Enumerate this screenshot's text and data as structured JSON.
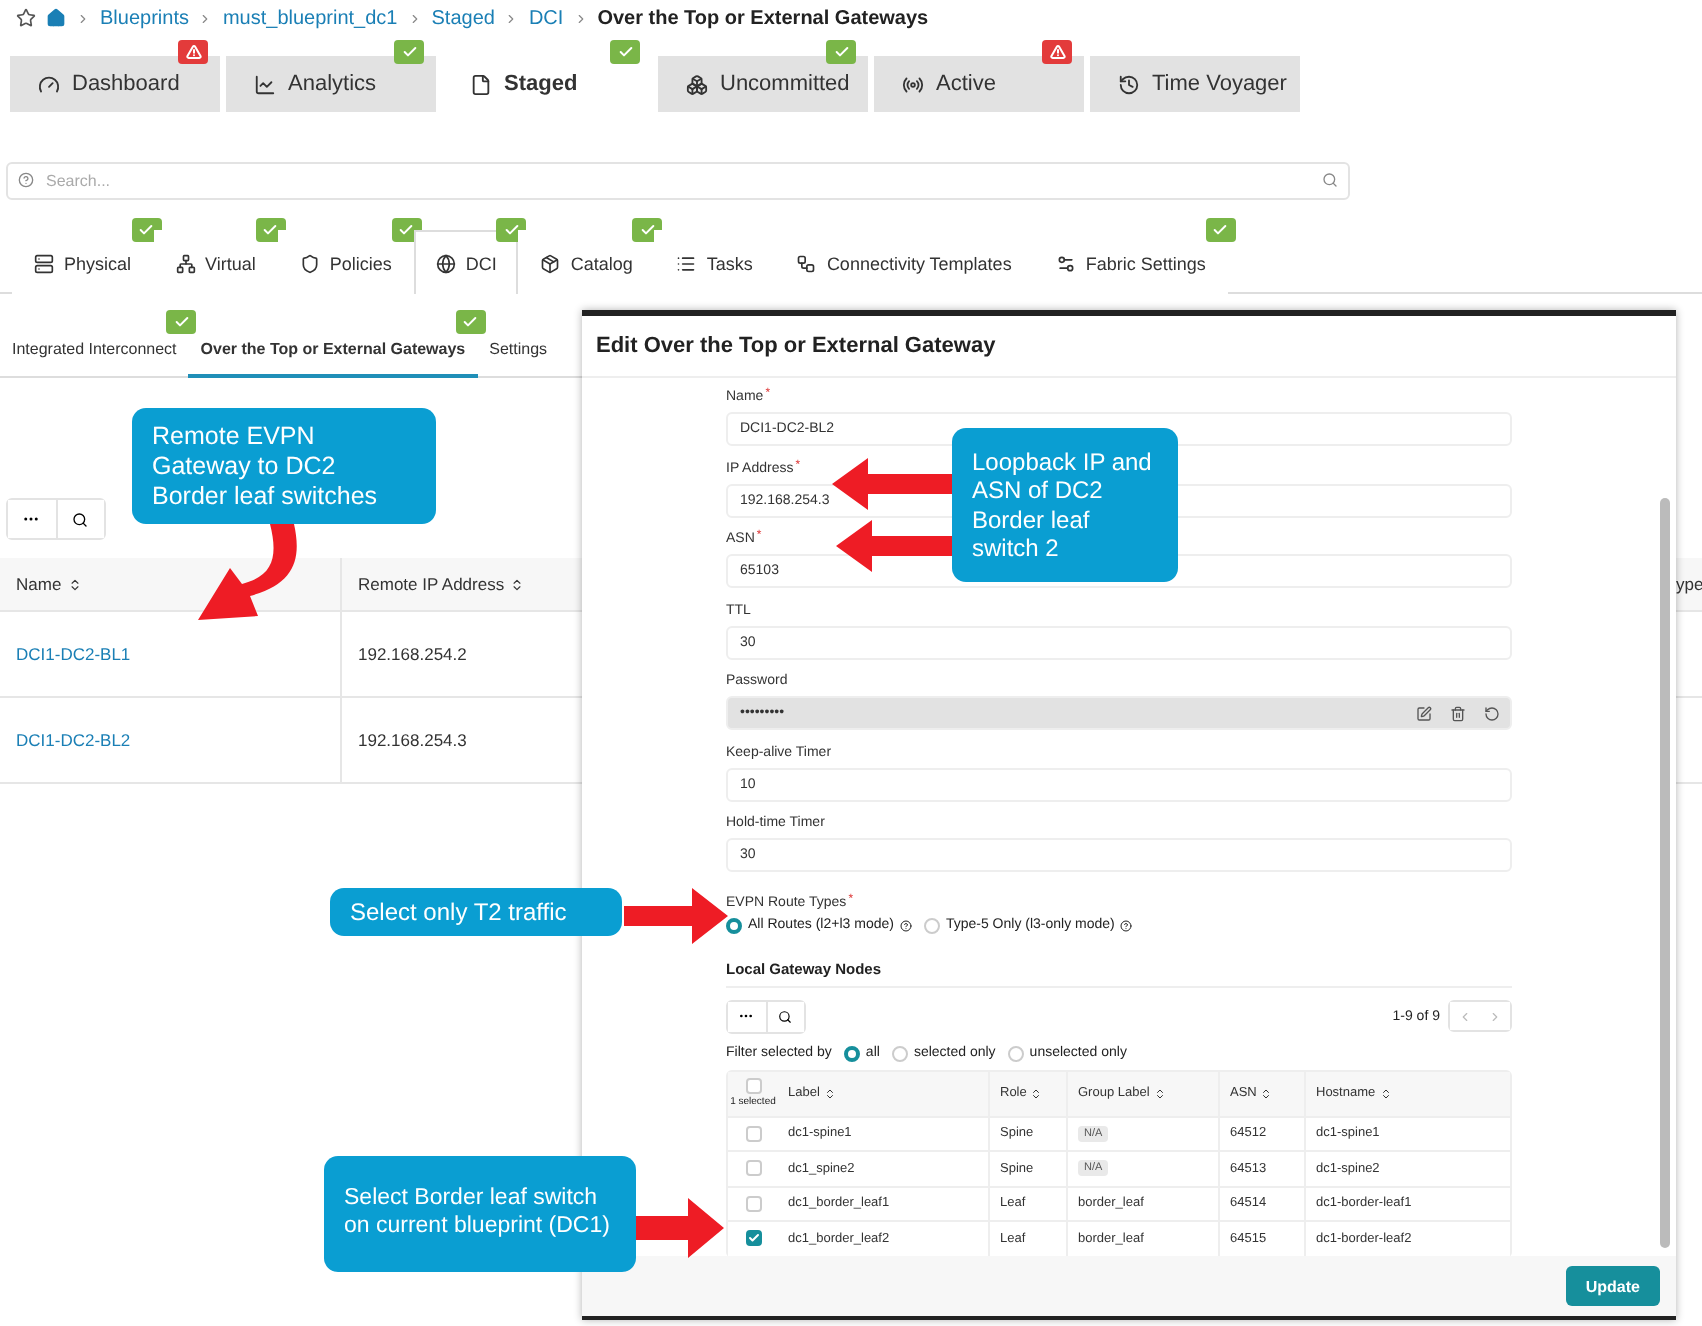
{
  "breadcrumb": [
    {
      "label": "Blueprints",
      "kind": "link"
    },
    {
      "label": "must_blueprint_dc1",
      "kind": "link"
    },
    {
      "label": "Staged",
      "kind": "link"
    },
    {
      "label": "DCI",
      "kind": "link"
    },
    {
      "label": "Over the Top or External Gateways",
      "kind": "current"
    }
  ],
  "main_tabs": [
    {
      "label": "Dashboard",
      "selected": false,
      "kind": "warning"
    },
    {
      "label": "Analytics",
      "selected": false,
      "kind": "ok"
    },
    {
      "label": "Staged",
      "selected": true,
      "kind": "ok"
    },
    {
      "label": "Uncommitted",
      "selected": false,
      "kind": "ok"
    },
    {
      "label": "Active",
      "selected": false,
      "kind": "warning"
    },
    {
      "label": "Time Voyager",
      "selected": false,
      "kind": "plain"
    }
  ],
  "search": {
    "placeholder": "Search..."
  },
  "blueprint_tabs": [
    {
      "label": "Physical",
      "selected": false,
      "kind": "ok"
    },
    {
      "label": "Virtual",
      "selected": false,
      "kind": "ok"
    },
    {
      "label": "Policies",
      "selected": false,
      "kind": "ok"
    },
    {
      "label": "DCI",
      "selected": true,
      "kind": "ok"
    },
    {
      "label": "Catalog",
      "selected": false,
      "kind": "ok"
    },
    {
      "label": "Tasks",
      "selected": false,
      "kind": "plain"
    },
    {
      "label": "Connectivity Templates",
      "selected": false,
      "kind": "plain"
    },
    {
      "label": "Fabric Settings",
      "selected": false,
      "kind": "ok"
    }
  ],
  "dci_tabs": [
    {
      "label": "Integrated Interconnect",
      "selected": false,
      "kind": "ok"
    },
    {
      "label": "Over the Top or External Gateways",
      "selected": true,
      "kind": "ok"
    },
    {
      "label": "Settings",
      "selected": false,
      "kind": "plain"
    }
  ],
  "gateways_table": {
    "columns": [
      "Name",
      "Remote IP Address",
      "ype"
    ],
    "rows": [
      [
        "DCI1-DC2-BL1",
        "192.168.254.2"
      ],
      [
        "DCI1-DC2-BL2",
        "192.168.254.3"
      ]
    ]
  },
  "modal": {
    "title": "Edit Over the Top or External Gateway",
    "fields": [
      {
        "label": "Name",
        "marker": "*",
        "kind": "text",
        "value": "DCI1-DC2-BL2"
      },
      {
        "label": "IP Address",
        "marker": "*",
        "kind": "text",
        "value": "192.168.254.3"
      },
      {
        "label": "ASN",
        "marker": "*",
        "kind": "text",
        "value": "65103"
      },
      {
        "label": "TTL",
        "kind": "text",
        "value": "30"
      },
      {
        "label": "Password",
        "kind": "password",
        "value": "•••••••••"
      },
      {
        "label": "Keep-alive Timer",
        "kind": "text",
        "value": "10"
      },
      {
        "label": "Hold-time Timer",
        "kind": "text",
        "value": "30"
      }
    ],
    "route_types": {
      "label": "EVPN Route Types",
      "marker": "*",
      "options": [
        {
          "label": "All Routes (l2+l3 mode)",
          "selected": true
        },
        {
          "label": "Type-5 Only (l3-only mode)",
          "selected": false
        }
      ]
    },
    "local_nodes": {
      "title": "Local Gateway Nodes",
      "pagination": "1-9 of 9",
      "filter_label": "Filter selected by",
      "filter_options": [
        {
          "label": "all",
          "selected": true
        },
        {
          "label": "selected only",
          "selected": false
        },
        {
          "label": "unselected only",
          "selected": false
        }
      ],
      "select_all_checked": false,
      "selected_count": "1 selected",
      "columns": [
        "Label",
        "Role",
        "Group Label",
        "ASN",
        "Hostname"
      ],
      "rows": [
        {
          "checked": false,
          "label": "dc1-spine1",
          "role": "Spine",
          "group_label": "N/A",
          "group_tag": true,
          "asn": "64512",
          "hostname": "dc1-spine1"
        },
        {
          "checked": false,
          "label": "dc1_spine2",
          "role": "Spine",
          "group_label": "N/A",
          "group_tag": true,
          "asn": "64513",
          "hostname": "dc1-spine2"
        },
        {
          "checked": false,
          "label": "dc1_border_leaf1",
          "role": "Leaf",
          "group_label": "border_leaf",
          "group_tag": false,
          "asn": "64514",
          "hostname": "dc1-border-leaf1"
        },
        {
          "checked": true,
          "label": "dc1_border_leaf2",
          "role": "Leaf",
          "group_label": "border_leaf",
          "group_tag": false,
          "asn": "64515",
          "hostname": "dc1-border-leaf2"
        }
      ]
    },
    "submit": "Update"
  },
  "callouts": [
    {
      "text": "Remote EVPN Gateway to DC2 Border leaf switches"
    },
    {
      "text": "Loopback IP and ASN of DC2 Border leaf switch 2"
    },
    {
      "text": "Select only T2 traffic"
    },
    {
      "text": "Select Border leaf switch on current blueprint (DC1)"
    }
  ]
}
